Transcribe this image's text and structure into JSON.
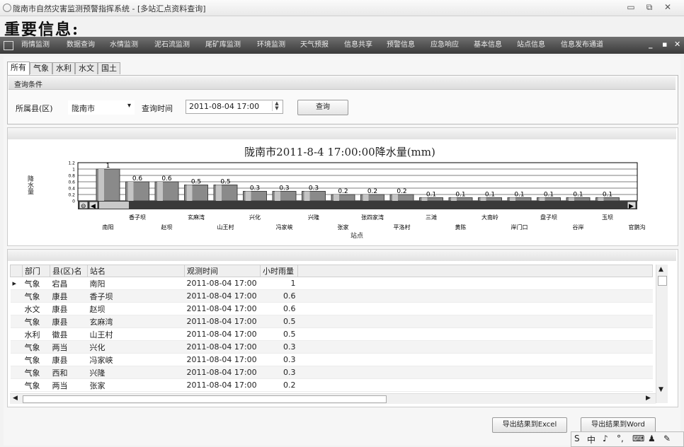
{
  "window": {
    "title": "陇南市自然灾害监测预警指挥系统 - [多站汇点资料查询]",
    "controls": [
      "▭",
      "⧉",
      "✕"
    ]
  },
  "notice": "重要信息:",
  "menu": {
    "items": [
      "雨情监测",
      "数据查询",
      "水情监测",
      "泥石流监测",
      "尾矿库监测",
      "环境监测",
      "天气预报",
      "信息共享",
      "预警信息",
      "应急响应",
      "基本信息",
      "站点信息",
      "信息发布通道"
    ],
    "controls": [
      "_",
      "▪",
      "✕"
    ]
  },
  "tabs": [
    "所有",
    "气象",
    "水利",
    "水文",
    "国土"
  ],
  "query": {
    "group_title": "查询条件",
    "county_label": "所属县(区)",
    "county_value": "陇南市",
    "time_label": "查询时间",
    "time_value": "2011-08-04 17:00",
    "submit": "查询"
  },
  "chart_data": {
    "type": "bar",
    "title": "陇南市2011-8-4  17:00:00降水量(mm)",
    "xlabel": "站点",
    "ylabel": "降水量",
    "ylim": [
      0,
      1.2
    ],
    "yticks": [
      "1.2",
      "1",
      "0.8",
      "0.6",
      "0.4",
      "0.2",
      "0"
    ],
    "categories": [
      "南阳",
      "香子坝",
      "赵坝",
      "玄麻湾",
      "山王村",
      "兴化",
      "冯家峡",
      "兴隆",
      "张家",
      "张四家湾",
      "平洛村",
      "三滩",
      "黄陈",
      "大南岭",
      "岸门口",
      "盘子坝",
      "谷岸",
      "玉坝",
      "官鹅沟"
    ],
    "values": [
      1,
      0.6,
      0.6,
      0.5,
      0.5,
      0.3,
      0.3,
      0.3,
      0.2,
      0.2,
      0.2,
      0.1,
      0.1,
      0.1,
      0.1,
      0.1,
      0.1,
      0.1
    ],
    "data_labels": [
      "1",
      "0.6",
      "0.6",
      "0.5",
      "0.5",
      "0.3",
      "0.3",
      "0.3",
      "0.2",
      "0.2",
      "0.2",
      "0.1",
      "0.1",
      "0.1",
      "0.1",
      "0.1",
      "0.1",
      "0.1"
    ]
  },
  "table": {
    "columns": [
      "部门",
      "县(区)名",
      "站名",
      "观测时间",
      "小时雨量"
    ],
    "rows": [
      [
        "气象",
        "宕昌",
        "南阳",
        "2011-08-04 17:00",
        "1"
      ],
      [
        "气象",
        "康县",
        "香子坝",
        "2011-08-04 17:00",
        "0.6"
      ],
      [
        "水文",
        "康县",
        "赵坝",
        "2011-08-04 17:00",
        "0.6"
      ],
      [
        "气象",
        "康县",
        "玄麻湾",
        "2011-08-04 17:00",
        "0.5"
      ],
      [
        "水利",
        "徽县",
        "山王村",
        "2011-08-04 17:00",
        "0.5"
      ],
      [
        "气象",
        "两当",
        "兴化",
        "2011-08-04 17:00",
        "0.3"
      ],
      [
        "气象",
        "康县",
        "冯家峡",
        "2011-08-04 17:00",
        "0.3"
      ],
      [
        "气象",
        "西和",
        "兴隆",
        "2011-08-04 17:00",
        "0.3"
      ],
      [
        "气象",
        "两当",
        "张家",
        "2011-08-04 17:00",
        "0.2"
      ]
    ],
    "current_row_marker": "▸"
  },
  "export": {
    "excel": "导出结果到Excel",
    "word": "导出结果到Word"
  },
  "ime": [
    "S",
    "中",
    "♪",
    "°,",
    "⌨",
    "♟",
    "✎"
  ]
}
